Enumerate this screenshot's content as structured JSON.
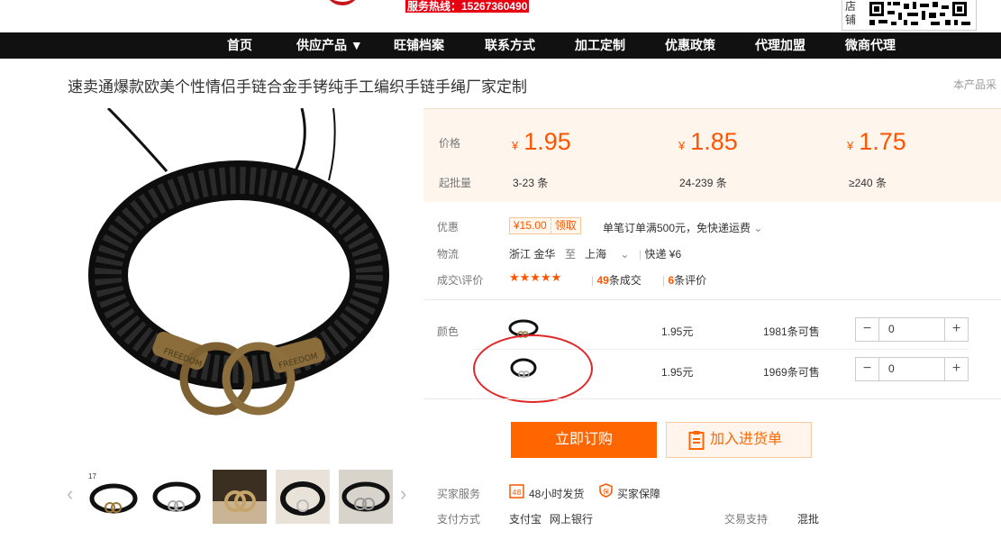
{
  "header": {
    "hotline": "服务热线：15267360490",
    "shop_label": "店铺"
  },
  "nav": {
    "items": [
      "首页",
      "供应产品 ▼",
      "旺铺档案",
      "联系方式",
      "加工定制",
      "优惠政策",
      "代理加盟",
      "微商代理"
    ]
  },
  "product": {
    "title": "速卖通爆款欧美个性情侣手链合金手铐纯手工编织手链手绳厂家定制",
    "side_note": "本产品采"
  },
  "price_panel": {
    "price_label": "价格",
    "batch_label": "起批量",
    "tiers": [
      {
        "currency": "¥",
        "price": "1.95",
        "range": "3-23 条"
      },
      {
        "currency": "¥",
        "price": "1.85",
        "range": "24-239 条"
      },
      {
        "currency": "¥",
        "price": "1.75",
        "range": "≥240 条"
      }
    ]
  },
  "promo": {
    "label": "优惠",
    "coupon_amount": "¥15.00",
    "coupon_action": "领取",
    "text": "单笔订单满500元，免快递运费"
  },
  "logistics": {
    "label": "物流",
    "from": "浙江 金华",
    "to_word": "至",
    "to": "上海",
    "express": "快递 ¥6"
  },
  "deals": {
    "label": "成交\\评价",
    "stars": "★★★★★",
    "deal_count": "49",
    "deal_suffix": "条成交",
    "review_count": "6",
    "review_suffix": "条评价"
  },
  "sku": {
    "label": "颜色",
    "rows": [
      {
        "price": "1.95元",
        "stock": "1981条可售",
        "qty": "0"
      },
      {
        "price": "1.95元",
        "stock": "1969条可售",
        "qty": "0"
      }
    ]
  },
  "actions": {
    "buy": "立即订购",
    "cart": "加入进货单"
  },
  "services": {
    "label": "买家服务",
    "item1": "48小时发货",
    "item2": "买家保障",
    "item1_icon_text": "48",
    "item2_icon_text": "保"
  },
  "payment": {
    "label": "支付方式",
    "methods": "支付宝",
    "bank": "网上银行",
    "trade_label": "交易支持",
    "trade_value": "混批"
  },
  "colors": {
    "accent": "#ff5500",
    "nav_bg": "#111111",
    "price_bg": "#fef5ec",
    "annotation": "#e0282b"
  }
}
